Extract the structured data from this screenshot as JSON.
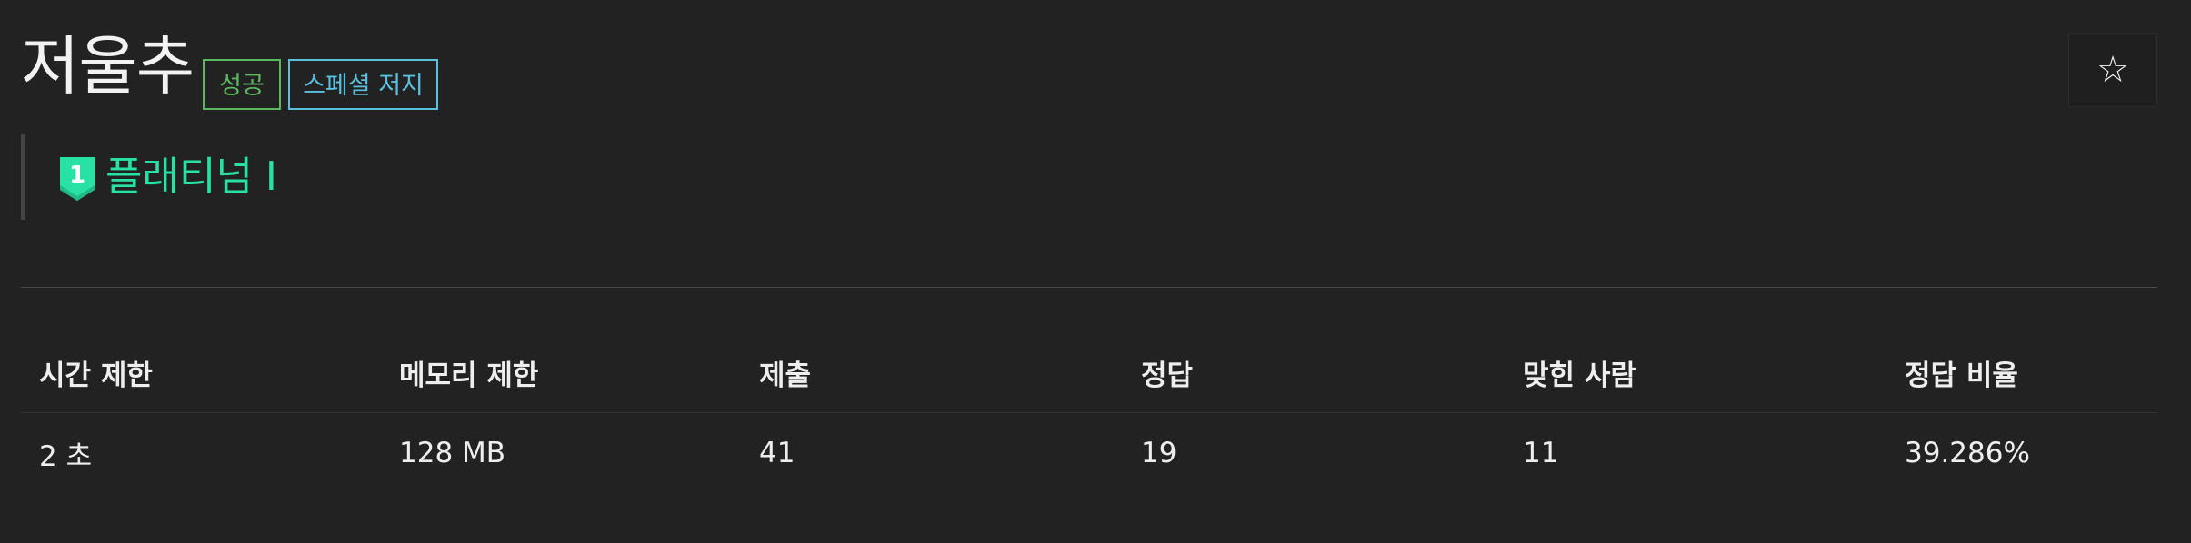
{
  "problem": {
    "title": "저울추",
    "tags": {
      "success": "성공",
      "special_judge": "스페셜 저지"
    },
    "tier": {
      "label": "플래티넘 I",
      "icon_number": "1",
      "icon": "platinum-tier-icon"
    },
    "star_icon": "☆"
  },
  "colors": {
    "background": "#222222",
    "success": "#5cb85c",
    "special_judge": "#5bc0de",
    "tier": "#27e2a4"
  },
  "info": {
    "headers": [
      "시간 제한",
      "메모리 제한",
      "제출",
      "정답",
      "맞힌 사람",
      "정답 비율"
    ],
    "values": [
      "2 초",
      "128 MB",
      "41",
      "19",
      "11",
      "39.286%"
    ]
  }
}
